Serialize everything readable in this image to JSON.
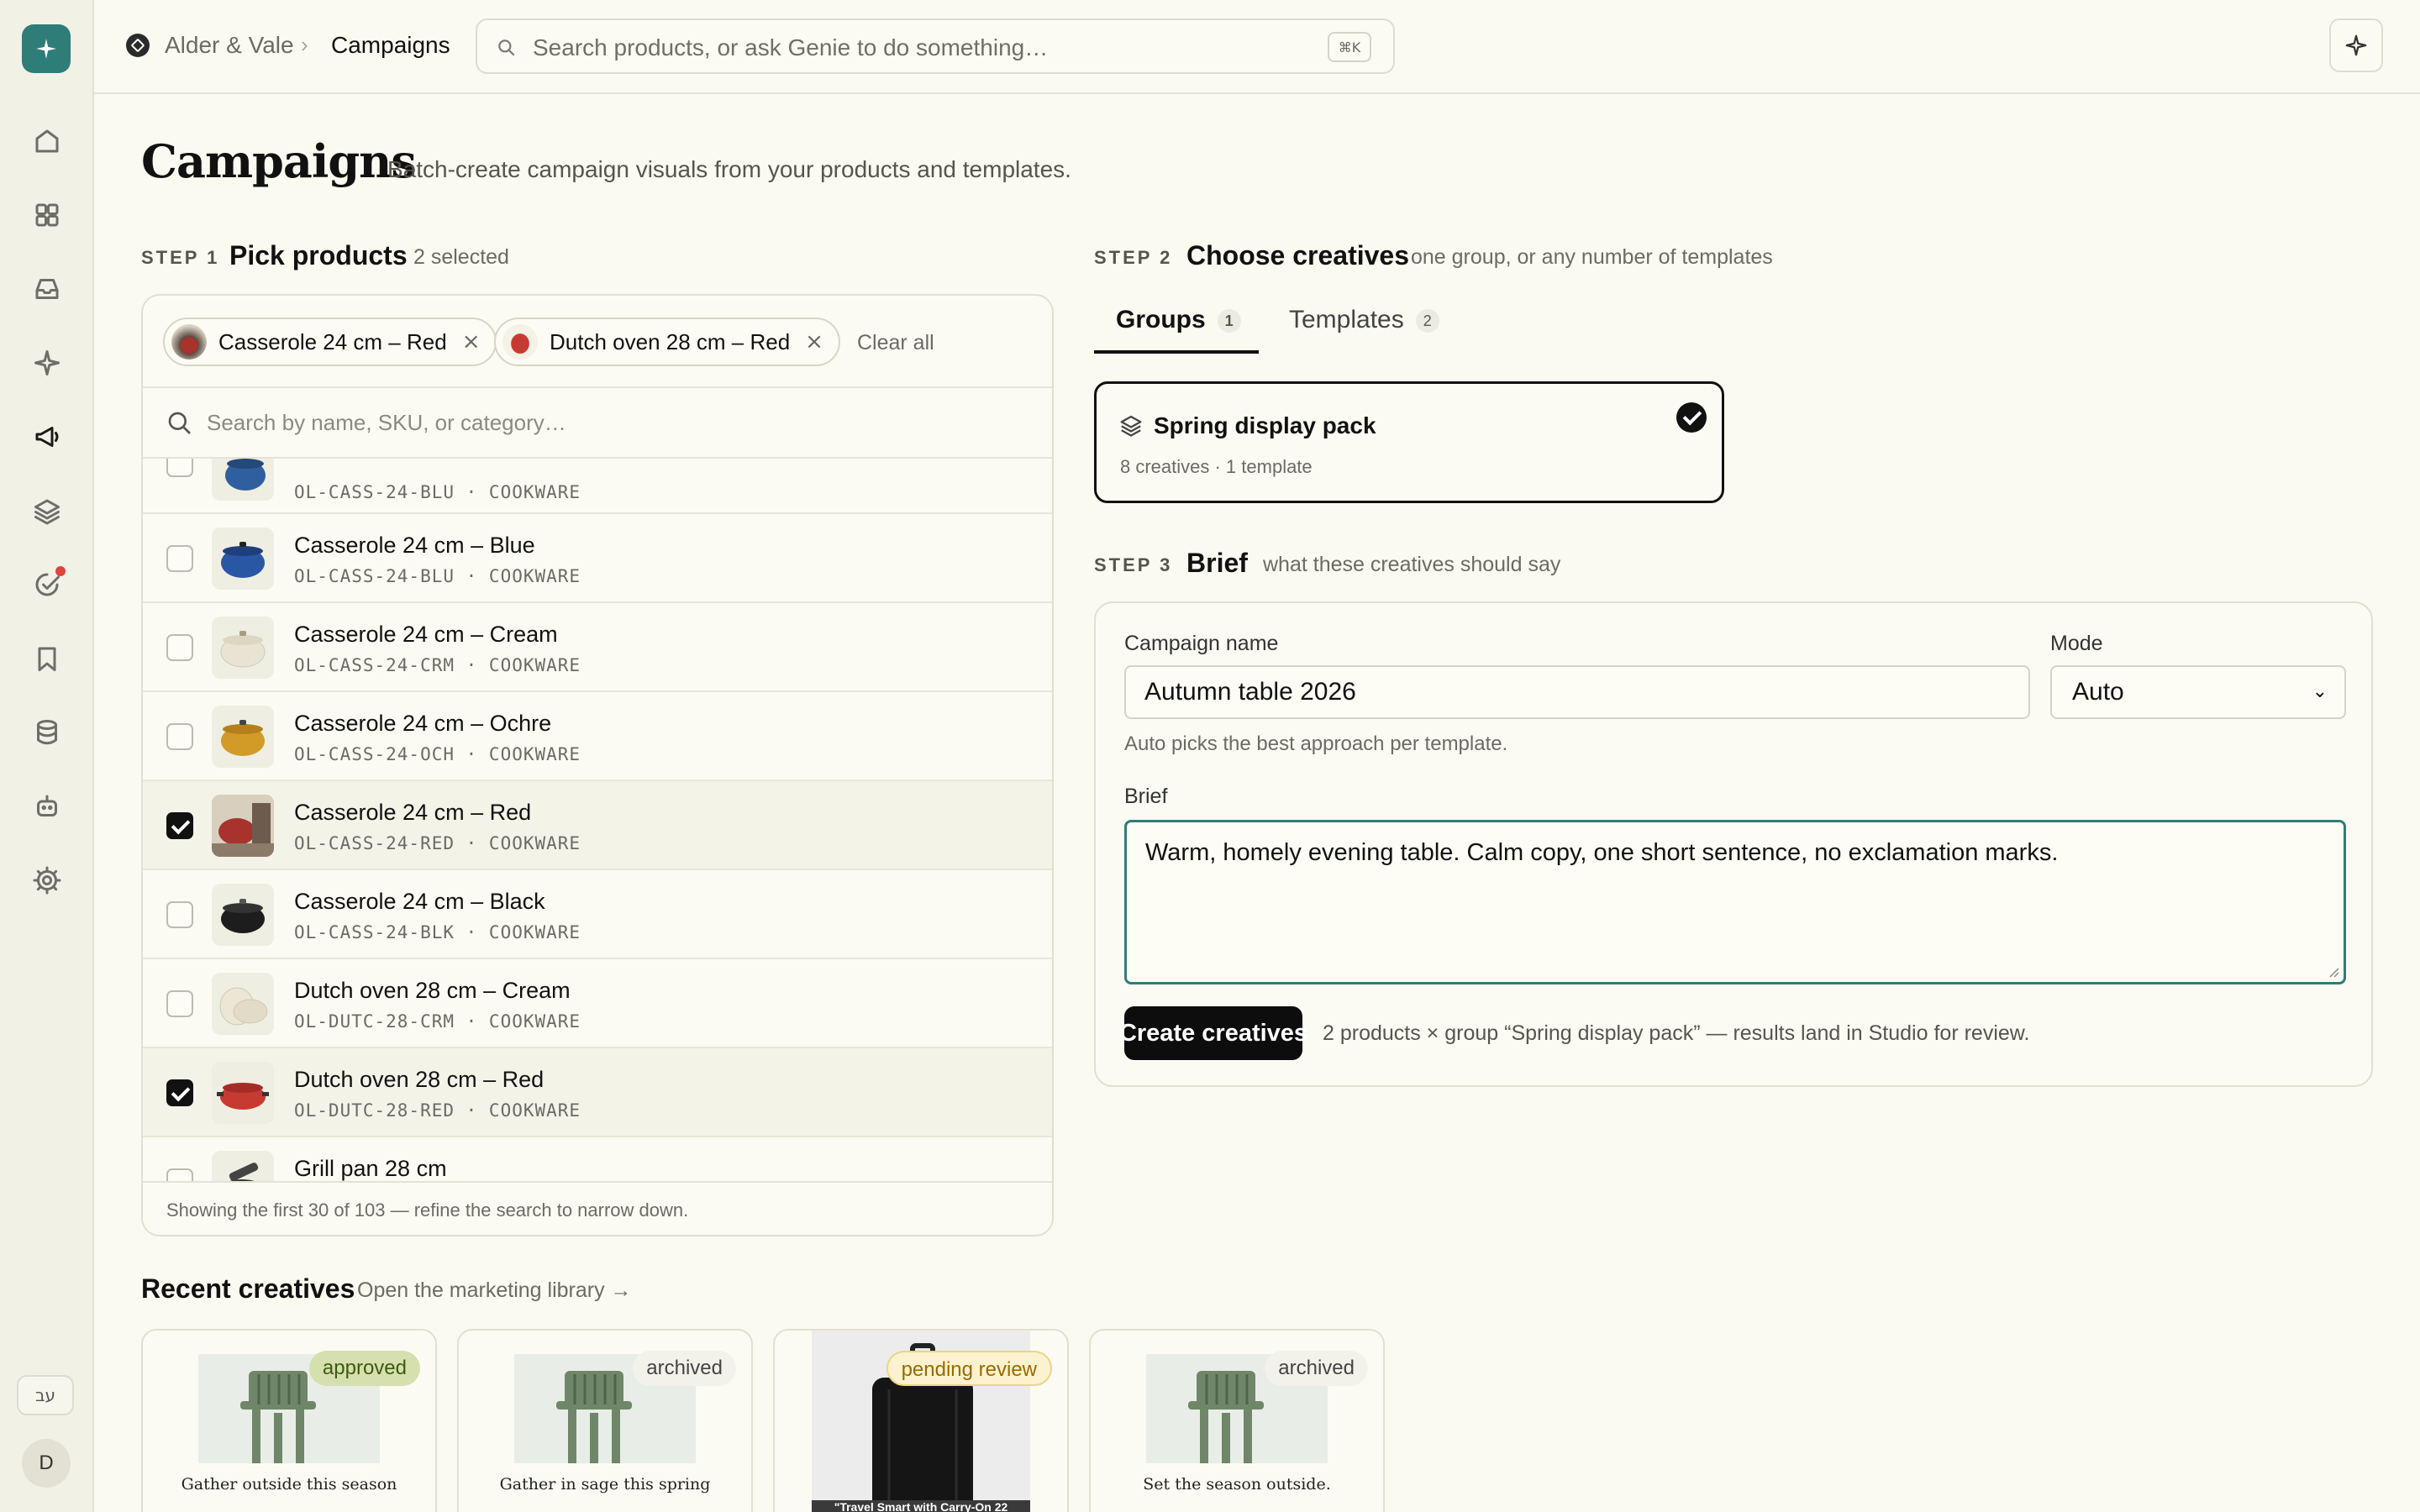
{
  "sidebar": {
    "items": [
      "home-icon",
      "grid-icon",
      "inbox-icon",
      "sparkle-icon",
      "megaphone-icon",
      "layers-icon",
      "tasks-icon",
      "bookmark-icon",
      "database-icon",
      "robot-icon",
      "gear-icon"
    ],
    "lang": "עב",
    "avatar": "D"
  },
  "topbar": {
    "workspace": "Alder & Vale",
    "page": "Campaigns",
    "search_placeholder": "Search products, or ask Genie to do something…",
    "shortcut": "⌘K"
  },
  "page": {
    "title": "Campaigns",
    "subtitle": "Batch-create campaign visuals from your products and templates."
  },
  "step1": {
    "label": "STEP 1",
    "title": "Pick products",
    "count": "2 selected",
    "chips": [
      {
        "label": "Casserole 24 cm – Red"
      },
      {
        "label": "Dutch oven 28 cm – Red"
      }
    ],
    "clear_all": "Clear all",
    "search_placeholder": "Search by name, SKU, or category…",
    "products": [
      {
        "name": "",
        "sku": "OL-CASS-24-BLU · COOKWARE",
        "selected": false,
        "color": "#2f5f9e"
      },
      {
        "name": "Casserole 24 cm – Blue",
        "sku": "OL-CASS-24-BLU · COOKWARE",
        "selected": false,
        "color": "#2a56a6"
      },
      {
        "name": "Casserole 24 cm – Cream",
        "sku": "OL-CASS-24-CRM · COOKWARE",
        "selected": false,
        "color": "#e9e3d3"
      },
      {
        "name": "Casserole 24 cm – Ochre",
        "sku": "OL-CASS-24-OCH · COOKWARE",
        "selected": false,
        "color": "#d29a27"
      },
      {
        "name": "Casserole 24 cm – Red",
        "sku": "OL-CASS-24-RED · COOKWARE",
        "selected": true,
        "color": "#a8322c"
      },
      {
        "name": "Casserole 24 cm – Black",
        "sku": "OL-CASS-24-BLK · COOKWARE",
        "selected": false,
        "color": "#1d1d1d"
      },
      {
        "name": "Dutch oven 28 cm – Cream",
        "sku": "OL-DUTC-28-CRM · COOKWARE",
        "selected": false,
        "color": "#ece6d4"
      },
      {
        "name": "Dutch oven 28 cm – Red",
        "sku": "OL-DUTC-28-RED · COOKWARE",
        "selected": true,
        "color": "#c63a32"
      },
      {
        "name": "Grill pan 28 cm",
        "sku": "",
        "selected": false,
        "color": "#333333"
      }
    ],
    "footer": "Showing the first 30 of 103 — refine the search to narrow down."
  },
  "step2": {
    "label": "STEP 2",
    "title": "Choose creatives",
    "sub": "one group, or any number of templates",
    "tabs": [
      {
        "label": "Groups",
        "count": "1"
      },
      {
        "label": "Templates",
        "count": "2"
      }
    ],
    "group": {
      "name": "Spring display pack",
      "meta": "8 creatives · 1 template"
    }
  },
  "step3": {
    "label": "STEP 3",
    "title": "Brief",
    "sub": "what these creatives should say",
    "campaign_name_label": "Campaign name",
    "campaign_name": "Autumn table 2026",
    "mode_label": "Mode",
    "mode": "Auto",
    "mode_help": "Auto picks the best approach per template.",
    "brief_label": "Brief",
    "brief": "Warm, homely evening table. Calm copy, one short sentence, no exclamation marks.",
    "create_label": "Create creatives",
    "create_note": "2 products × group “Spring display pack” — results land in Studio for review."
  },
  "recent": {
    "title": "Recent creatives",
    "link": "Open the marketing library →",
    "cards": [
      {
        "status": "approved",
        "caption": "Gather outside this season"
      },
      {
        "status": "archived",
        "caption": "Gather in sage this spring"
      },
      {
        "status": "pending review",
        "caption": "\"Travel Smart with Carry-On 22"
      },
      {
        "status": "archived",
        "caption": "Set the season outside."
      }
    ]
  }
}
